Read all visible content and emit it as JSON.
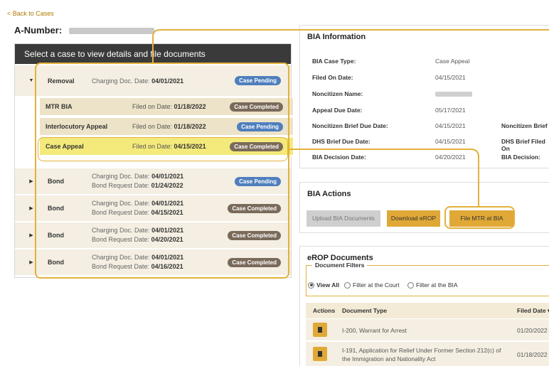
{
  "nav": {
    "back_label": "< Back to Cases"
  },
  "header": {
    "anumber_label": "A-Number:"
  },
  "case_panel": {
    "title": "Select a case to view details and file documents",
    "removal": {
      "type": "Removal",
      "charge_prefix": "Charging Doc. Date:",
      "charge_date": "04/01/2021",
      "status": "Case Pending",
      "children": [
        {
          "type": "MTR BIA",
          "prefix": "Filed on Date:",
          "date": "01/18/2022",
          "status": "Case Completed"
        },
        {
          "type": "Interlocutory Appeal",
          "prefix": "Filed on Date:",
          "date": "01/18/2022",
          "status": "Case Pending"
        },
        {
          "type": "Case Appeal",
          "prefix": "Filed on Date:",
          "date": "04/15/2021",
          "status": "Case Completed"
        }
      ]
    },
    "bonds": [
      {
        "type": "Bond",
        "charge_prefix": "Charging Doc. Date:",
        "charge_date": "04/01/2021",
        "request_prefix": "Bond Request Date:",
        "request_date": "01/24/2022",
        "status": "Case Pending"
      },
      {
        "type": "Bond",
        "charge_prefix": "Charging Doc. Date:",
        "charge_date": "04/01/2021",
        "request_prefix": "Bond Request Date:",
        "request_date": "04/15/2021",
        "status": "Case Completed"
      },
      {
        "type": "Bond",
        "charge_prefix": "Charging Doc. Date:",
        "charge_date": "04/01/2021",
        "request_prefix": "Bond Request Date:",
        "request_date": "04/20/2021",
        "status": "Case Completed"
      },
      {
        "type": "Bond",
        "charge_prefix": "Charging Doc. Date:",
        "charge_date": "04/01/2021",
        "request_prefix": "Bond Request Date:",
        "request_date": "04/16/2021",
        "status": "Case Completed"
      }
    ]
  },
  "bia_info": {
    "title": "BIA Information",
    "fields": [
      {
        "label": "BIA Case Type:",
        "value": "Case Appeal"
      },
      {
        "label": "Filed On Date:",
        "value": "04/15/2021"
      },
      {
        "label": "Noncitizen Name:",
        "value": ""
      },
      {
        "label": "Appeal Due Date:",
        "value": "05/17/2021"
      },
      {
        "label": "Noncitizen Brief Due Date:",
        "value": "04/15/2021"
      },
      {
        "label": "DHS Brief Due Date:",
        "value": "04/15/2021"
      },
      {
        "label": "BIA Decision Date:",
        "value": "04/20/2021"
      }
    ],
    "right_labels": [
      "Noncitizen Brief Fi",
      "DHS Brief Filed On",
      "BIA Decision:"
    ]
  },
  "bia_actions": {
    "title": "BIA Actions",
    "upload_label": "Upload BIA Documents",
    "download_label": "Download eROP",
    "file_mtr_label": "File MTR at BIA"
  },
  "erop": {
    "title": "eROP Documents",
    "filters_label": "Document Filters",
    "options": [
      "View All",
      "Filter at the Court",
      "Filter at the BIA"
    ],
    "columns": {
      "actions": "Actions",
      "doc_type": "Document Type",
      "filed": "Filed Date ▾"
    },
    "rows": [
      {
        "doc_type": "I-200, Warrant for Arrest",
        "doc_type2": "",
        "date": "01/20/2022"
      },
      {
        "doc_type": "I-191, Application for Relief Under Former Section 212(c) of",
        "doc_type2": "the Immigration and Nationality Act",
        "date": "01/18/2022"
      }
    ]
  },
  "colors": {
    "accent": "#e0a836",
    "pending": "#4f7fbd",
    "completed": "#7a6a5a",
    "header_dark": "#3a3a3a",
    "row_bg": "#f4efe2",
    "selected": "#f3ea7b"
  }
}
